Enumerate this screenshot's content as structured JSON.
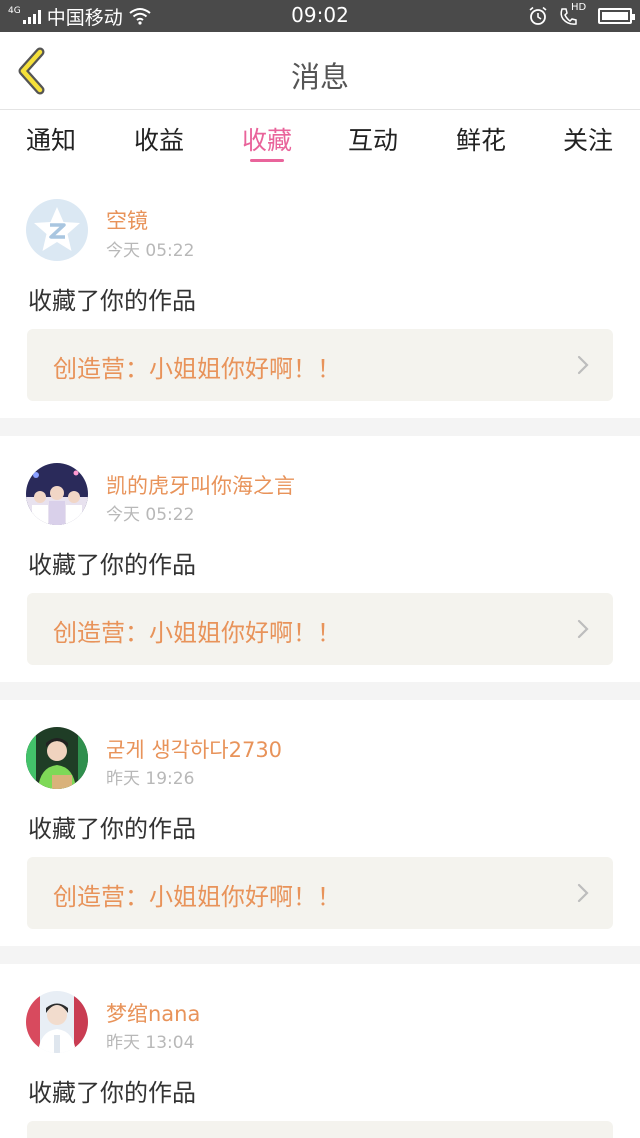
{
  "status_bar": {
    "network": "4G",
    "carrier": "中国移动",
    "time": "09:02",
    "hd_label": "HD",
    "battery_level": 1.0
  },
  "nav": {
    "title": "消息"
  },
  "tabs": [
    {
      "label": "通知",
      "active": false
    },
    {
      "label": "收益",
      "active": false
    },
    {
      "label": "收藏",
      "active": true
    },
    {
      "label": "互动",
      "active": false
    },
    {
      "label": "鲜花",
      "active": false
    },
    {
      "label": "关注",
      "active": false
    }
  ],
  "accent_color": "#e9649b",
  "name_color": "#e8935a",
  "messages": [
    {
      "username": "空镜",
      "time": "今天 05:22",
      "action": "收藏了你的作品",
      "work": "创造营：小姐姐你好啊！！"
    },
    {
      "username": "凯的虎牙叫你海之言",
      "time": "今天 05:22",
      "action": "收藏了你的作品",
      "work": "创造营：小姐姐你好啊！！"
    },
    {
      "username": "굳게 생각하다2730",
      "time": "昨天 19:26",
      "action": "收藏了你的作品",
      "work": "创造营：小姐姐你好啊！！"
    },
    {
      "username": "梦绾nana",
      "time": "昨天 13:04",
      "action": "收藏了你的作品",
      "work": ""
    }
  ]
}
